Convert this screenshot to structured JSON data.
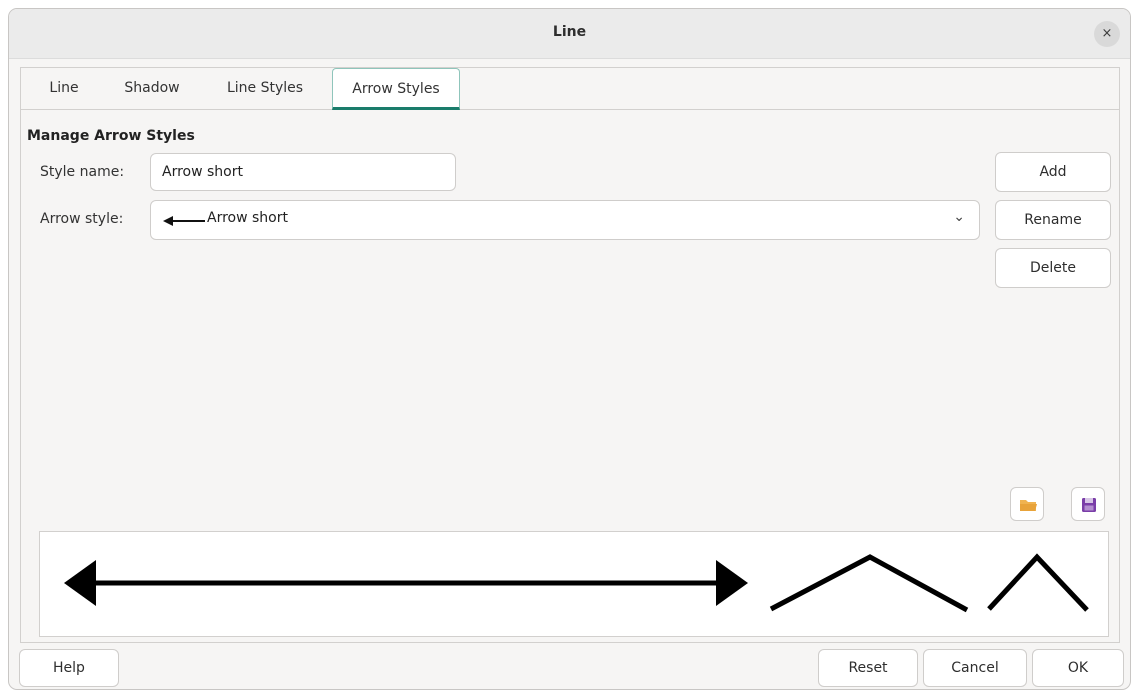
{
  "window": {
    "title": "Line",
    "close_glyph": "×"
  },
  "tabs": [
    {
      "label": "Line",
      "active": false
    },
    {
      "label": "Shadow",
      "active": false
    },
    {
      "label": "Line Styles",
      "active": false
    },
    {
      "label": "Arrow Styles",
      "active": true
    }
  ],
  "manage": {
    "section_title": "Manage Arrow Styles",
    "style_name_label": "Style name:",
    "style_name_value": "Arrow short",
    "arrow_style_label": "Arrow style:",
    "arrow_style_value": "Arrow short",
    "add_label": "Add",
    "rename_label": "Rename",
    "delete_label": "Delete"
  },
  "icons": {
    "load": "open-folder-icon",
    "save": "save-floppy-icon"
  },
  "footer": {
    "help_label": "Help",
    "reset_label": "Reset",
    "cancel_label": "Cancel",
    "ok_label": "OK"
  },
  "colors": {
    "accent": "#1a7c6b",
    "folder": "#e8a33a",
    "floppy": "#7a3ea8"
  }
}
